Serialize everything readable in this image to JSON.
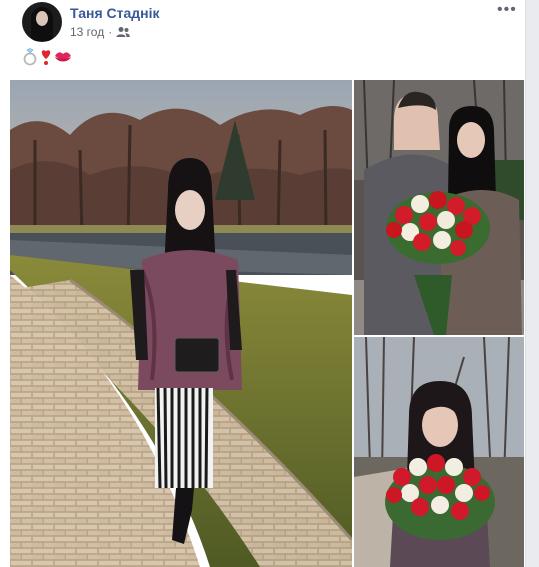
{
  "post": {
    "author": "Таня Стаднік",
    "time": "13 год",
    "privacy_icon": "friends-icon",
    "more_icon": "more-options-icon",
    "content_emoji": [
      "ring",
      "heavy-heart-exclamation",
      "kiss-mark"
    ]
  },
  "photos": [
    {
      "name": "photo-park-walk",
      "description_icon": "photo"
    },
    {
      "name": "photo-couple-roses",
      "description_icon": "photo"
    },
    {
      "name": "photo-woman-roses",
      "description_icon": "photo"
    }
  ],
  "colors": {
    "author_link": "#385898",
    "meta_text": "#606770",
    "background": "#e9ebee"
  }
}
